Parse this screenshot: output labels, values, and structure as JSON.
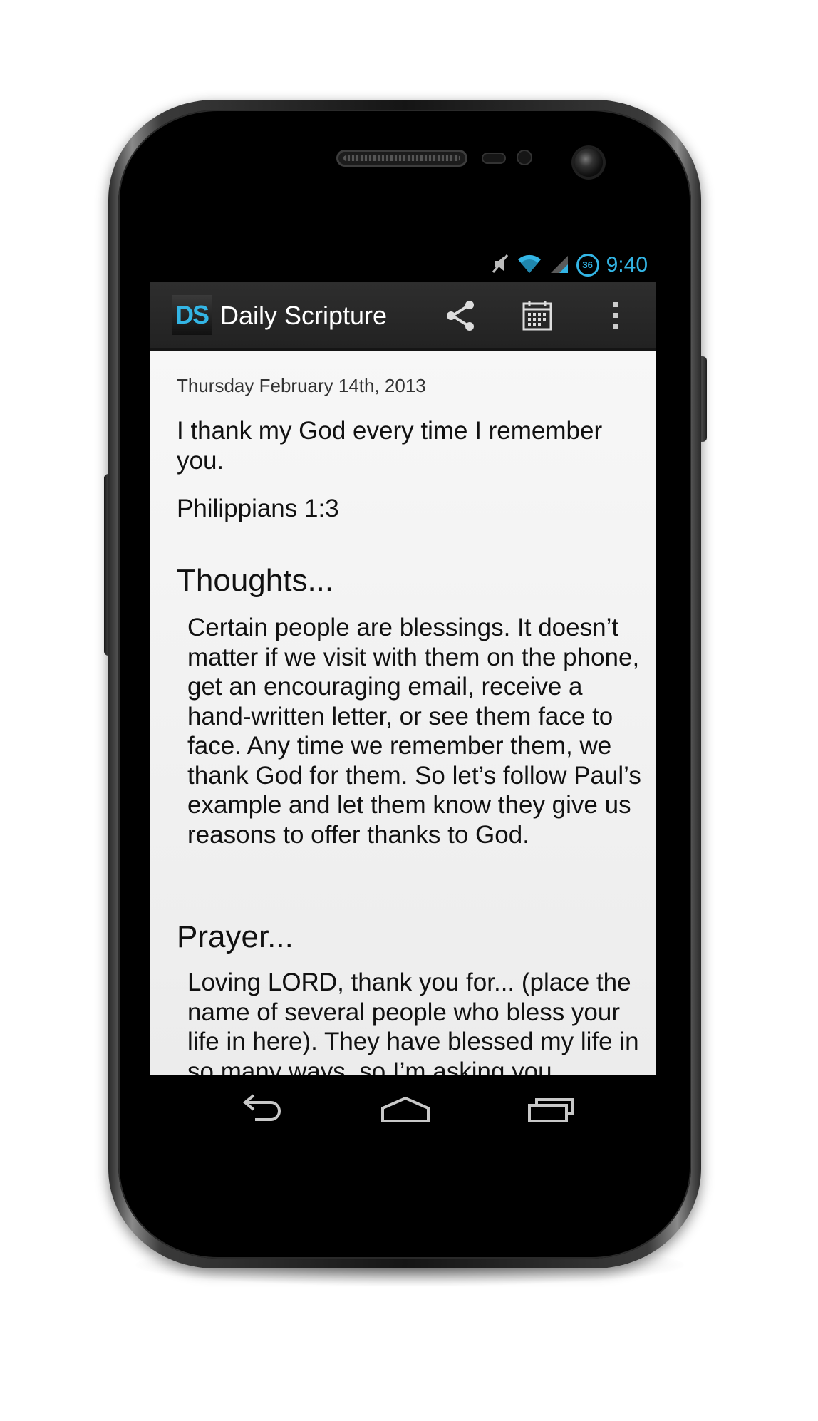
{
  "status_bar": {
    "time": "9:40",
    "badge": "36",
    "icons": [
      "mute-icon",
      "wifi-icon",
      "signal-icon",
      "badge-icon"
    ]
  },
  "action_bar": {
    "logo_text": "DS",
    "title": "Daily Scripture",
    "actions": [
      "share-icon",
      "calendar-icon",
      "overflow-menu-icon"
    ]
  },
  "content": {
    "date": "Thursday February 14th, 2013",
    "verse": "I thank my God every time I remember you.",
    "reference": "Philippians 1:3",
    "thoughts_heading": "Thoughts...",
    "thoughts_body": "Certain people are blessings. It doesn’t matter if we visit with them on the phone, get an encouraging email, receive a hand-written letter, or see them face to face. Any time we remember them, we thank God for them. So let’s follow Paul’s example and let them know they give us reasons to offer thanks to God.",
    "prayer_heading": "Prayer...",
    "prayer_body": "Loving LORD, thank you for... (place the name of several people who bless your life in here). They have blessed my life in so many ways, so I’m asking you"
  },
  "nav_bar": {
    "buttons": [
      "back-icon",
      "home-icon",
      "recent-apps-icon"
    ]
  },
  "colors": {
    "accent": "#33b5e5",
    "action_bar": "#262626",
    "content_bg": "#f2f2f2"
  }
}
